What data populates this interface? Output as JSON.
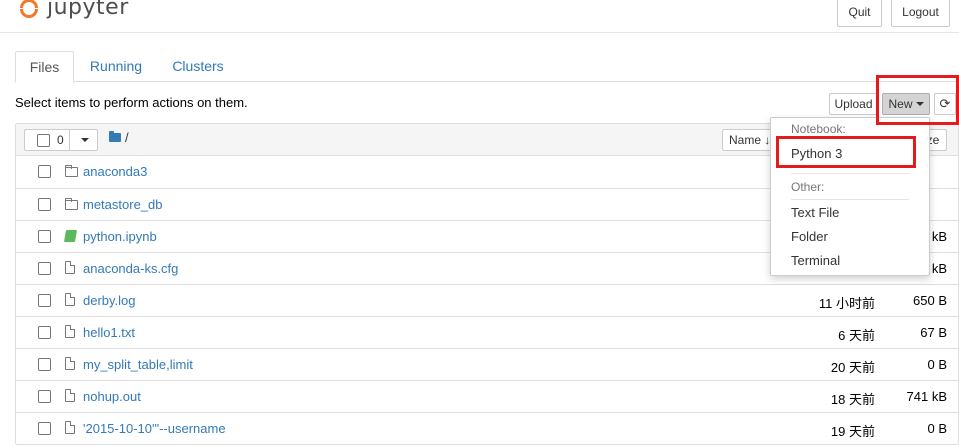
{
  "header": {
    "logo_text": "jupyter",
    "quit_label": "Quit",
    "logout_label": "Logout"
  },
  "tabs": [
    {
      "label": "Files"
    },
    {
      "label": "Running"
    },
    {
      "label": "Clusters"
    }
  ],
  "toolbar": {
    "hint": "Select items to perform actions on them.",
    "upload_label": "Upload",
    "new_label": "New",
    "refresh_icon": "refresh-icon"
  },
  "list_header": {
    "selected_count": "0",
    "path": "/",
    "name_sort_label": "Name ↓",
    "size_sort_label": "ze"
  },
  "files": [
    {
      "name": "anaconda3",
      "type": "folder",
      "date": "",
      "size": ""
    },
    {
      "name": "metastore_db",
      "type": "folder",
      "date": "",
      "size": ""
    },
    {
      "name": "python.ipynb",
      "type": "notebook",
      "date": "",
      "size": "kB"
    },
    {
      "name": "anaconda-ks.cfg",
      "type": "file",
      "date": "",
      "size": "kB"
    },
    {
      "name": "derby.log",
      "type": "file",
      "date": "11 小时前",
      "size": "650 B"
    },
    {
      "name": "hello1.txt",
      "type": "file",
      "date": "6 天前",
      "size": "67 B"
    },
    {
      "name": "my_split_table,limit",
      "type": "file",
      "date": "20 天前",
      "size": "0 B"
    },
    {
      "name": "nohup.out",
      "type": "file",
      "date": "18 天前",
      "size": "741 kB"
    },
    {
      "name": "'2015-10-10'\"--username",
      "type": "file",
      "date": "19 天前",
      "size": "0 B"
    }
  ],
  "new_menu": {
    "notebook_header": "Notebook:",
    "python3": "Python 3",
    "other_header": "Other:",
    "text_file": "Text File",
    "folder": "Folder",
    "terminal": "Terminal"
  },
  "colors": {
    "link": "#337ab7",
    "annotation": "#e41a1c",
    "logo": "#f37726"
  }
}
